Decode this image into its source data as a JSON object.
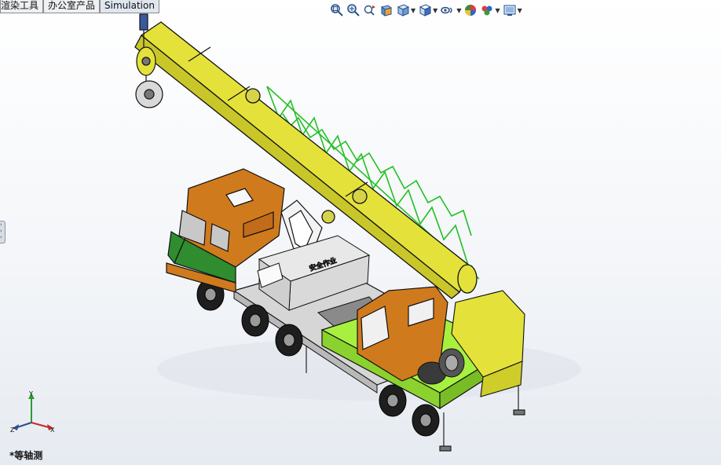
{
  "command_tabs": [
    {
      "label": "渲染工具"
    },
    {
      "label": "办公室产品"
    },
    {
      "label": "Simulation"
    }
  ],
  "heads_up_toolbar": [
    {
      "name": "zoom-to-fit-icon"
    },
    {
      "name": "zoom-to-area-icon"
    },
    {
      "name": "previous-view-icon"
    },
    {
      "name": "section-view-icon"
    },
    {
      "name": "view-orientation-icon",
      "dropdown": true
    },
    {
      "name": "display-style-icon",
      "dropdown": true
    },
    {
      "name": "hide-show-items-icon",
      "dropdown": true
    },
    {
      "name": "edit-appearance-icon"
    },
    {
      "name": "apply-scene-icon",
      "dropdown": true
    },
    {
      "name": "view-settings-icon",
      "dropdown": true
    }
  ],
  "triad": {
    "x_label": "X",
    "y_label": "Y",
    "z_label": "Z"
  },
  "view_label": "*等轴测",
  "model": {
    "sign_text": "安全作业"
  },
  "colors": {
    "boom": "#e4e23a",
    "cab": "#d07a1e",
    "deck": "#a8f040",
    "lattice": "#22c022",
    "tire": "#1e1e1e",
    "chassis": "#d8d8d8"
  }
}
